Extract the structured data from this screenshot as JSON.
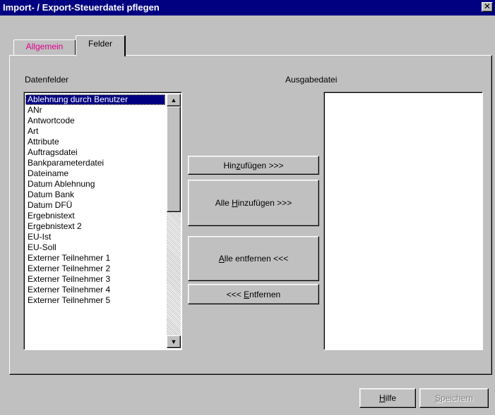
{
  "window": {
    "title": "Import- / Export-Steuerdatei pflegen",
    "close_glyph": "✕"
  },
  "tabs": [
    {
      "label": "Allgemein",
      "active": false,
      "color": "#e0008c"
    },
    {
      "label": "Felder",
      "active": true
    }
  ],
  "fields": {
    "available_label": "Datenfelder",
    "output_label": "Ausgabedatei",
    "items": [
      "Ablehnung durch Benutzer",
      "ANr",
      "Antwortcode",
      "Art",
      "Attribute",
      "Auftragsdatei",
      "Bankparameterdatei",
      "Dateiname",
      "Datum Ablehnung",
      "Datum Bank",
      "Datum DFÜ",
      "Ergebnistext",
      "Ergebnistext 2",
      "EU-Ist",
      "EU-Soll",
      "Externer Teilnehmer 1",
      "Externer Teilnehmer 2",
      "Externer Teilnehmer 3",
      "Externer Teilnehmer 4",
      "Externer Teilnehmer 5"
    ],
    "selected_index": 0,
    "output_items": []
  },
  "buttons": {
    "add": {
      "pre": "Hin",
      "key": "z",
      "post": "ufügen >>>"
    },
    "add_all": {
      "pre": "Alle ",
      "key": "H",
      "post": "inzufügen >>>"
    },
    "remove_all": {
      "pre": "",
      "key": "A",
      "post": "lle entfernen <<<"
    },
    "remove": {
      "pre": "<<< ",
      "key": "E",
      "post": "ntfernen"
    },
    "help": {
      "pre": "",
      "key": "H",
      "post": "ilfe"
    },
    "save": {
      "pre": "",
      "key": "S",
      "post": "peichern",
      "disabled": true
    }
  },
  "scrollbar": {
    "up_glyph": "▲",
    "down_glyph": "▼"
  }
}
